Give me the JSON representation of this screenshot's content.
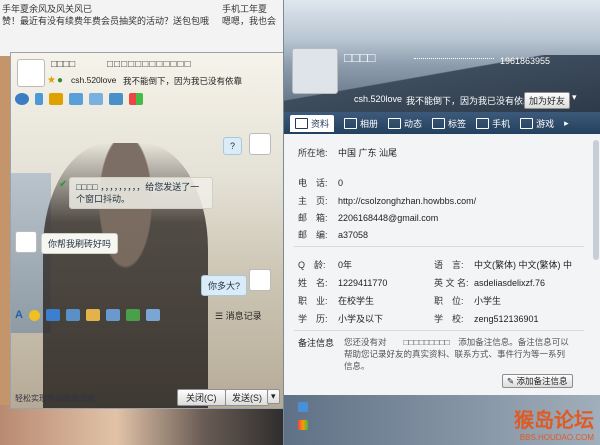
{
  "background": {
    "line1": "手年夏余风及风关风已",
    "line2": "赞！最近有没有续费年费会员抽奖的活动？送包包哦",
    "right1": "手机工年夏",
    "right2": "嗯嗯，我也会"
  },
  "chat": {
    "title_name": "□□□□",
    "title_tail": "□□□□□□□□□□□□",
    "account": "csh.520love",
    "status_msg": "我不能倒下，因为我已没有依靠",
    "messages": [
      {
        "side": "right",
        "text": "?"
      },
      {
        "side": "system",
        "text": "□□□□ ，，，，，，，，，给您发送了一个窗口抖动。"
      },
      {
        "side": "left",
        "text": "你帮我刷砖好吗"
      },
      {
        "side": "right",
        "text": "你多大?"
      }
    ],
    "history_label": "消息记录",
    "mobile_tip": "轻松实现移动网络流量",
    "close_label": "关闭(C)",
    "send_label": "发送(S)"
  },
  "profile": {
    "name": "□□□□",
    "qq_number": "1961863955",
    "account": "csh.520love",
    "status_msg": "我不能倒下，因为我已没有依靠",
    "add_friend_label": "加为好友",
    "tabs": [
      "资料",
      "相册",
      "动态",
      "标签",
      "手机",
      "游戏"
    ],
    "location_label": "所在地:",
    "location_value": "中国 广东 汕尾",
    "phone_label": "电　话:",
    "phone_value": "0",
    "homepage_label": "主　页:",
    "homepage_value": "http://csolzonghzhan.howbbs.com/",
    "email_label": "邮　箱:",
    "email_value": "2206168448@gmail.com",
    "zip_label": "邮　编:",
    "zip_value": "a37058",
    "age_label": "Q　龄:",
    "age_value": "0年",
    "lang_label": "语　言:",
    "lang_value": "中文(繁体)  中文(繁体)  中",
    "realname_label": "姓　名:",
    "realname_value": "1229411770",
    "engname_label": "英 文 名:",
    "engname_value": "asdeliasdelixzf.76",
    "job_label": "职　业:",
    "job_value": "在校学生",
    "position_label": "职　位:",
    "position_value": "小学生",
    "edu_label": "学　历:",
    "edu_value": "小学及以下",
    "school_label": "学　校:",
    "school_value": "zeng512136901",
    "note_label": "备注信息",
    "note_text": "您还没有对　　□□□□□□□□□　添加备注信息。备注信息可以帮助您记录好友的真实资料、联系方式、事件行为等一系列信息。",
    "add_note_label": "添加备注信息"
  },
  "watermark": {
    "title": "猴岛论坛",
    "url": "BBS.HOUDAO.COM"
  },
  "colors": {
    "accent": "#23405e",
    "link": "#1e5a96",
    "watermark": "#e05a24"
  }
}
